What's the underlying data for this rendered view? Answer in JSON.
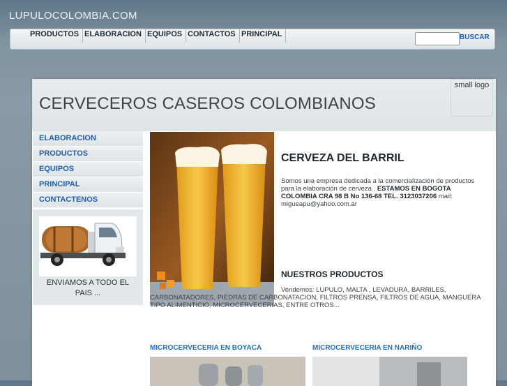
{
  "site_title": "LUPULOCOLOMBIA.COM",
  "nav": {
    "items": [
      "PRODUCTOS",
      "ELABORACION",
      "EQUIPOS",
      "CONTACTOS",
      "PRINCIPAL"
    ],
    "search_button": "BUSCAR",
    "search_value": ""
  },
  "header": {
    "title": "CERVECEROS CASEROS COLOMBIANOS",
    "logo_text": "small logo"
  },
  "sidebar": {
    "items": [
      "ELABORACION",
      "PRODUCTOS",
      "EQUIPOS",
      "PRINCIPAL",
      "CONTACTENOS"
    ],
    "promo_text": "ENVIAMOS A TODO EL PAIS ..."
  },
  "main": {
    "section_title": "CERVEZA DEL BARRIL",
    "intro_text": "Somos una empresa dedicada a la comercialización de productos para la elaboración de cerveza . ",
    "intro_bold": "ESTAMOS EN BOGOTA COLOMBIA CRA 98 B No 136-68 TEL. 3123037206",
    "intro_email": " mail: migueapu@yahoo.com.ar",
    "products_title": "NUESTROS PRODUCTOS",
    "products_text": "Vendemos: LUPULO, MALTA , LEVADURA, BARRILES, CARBONATADORES, PIEDRAS DE CARBONATACION, FILTROS PRENSA, FILTROS DE AGUA, MANGUERA TIPO ALIMENTICIO, MICROCERVECERIAS, ENTRE OTROS...",
    "links": [
      "MICROCERVECERIA EN BOYACA",
      "MICROCERVECERIA EN NARIÑO"
    ]
  },
  "colors": {
    "link_blue": "#1f5fa8",
    "heading": "#1f272d"
  }
}
